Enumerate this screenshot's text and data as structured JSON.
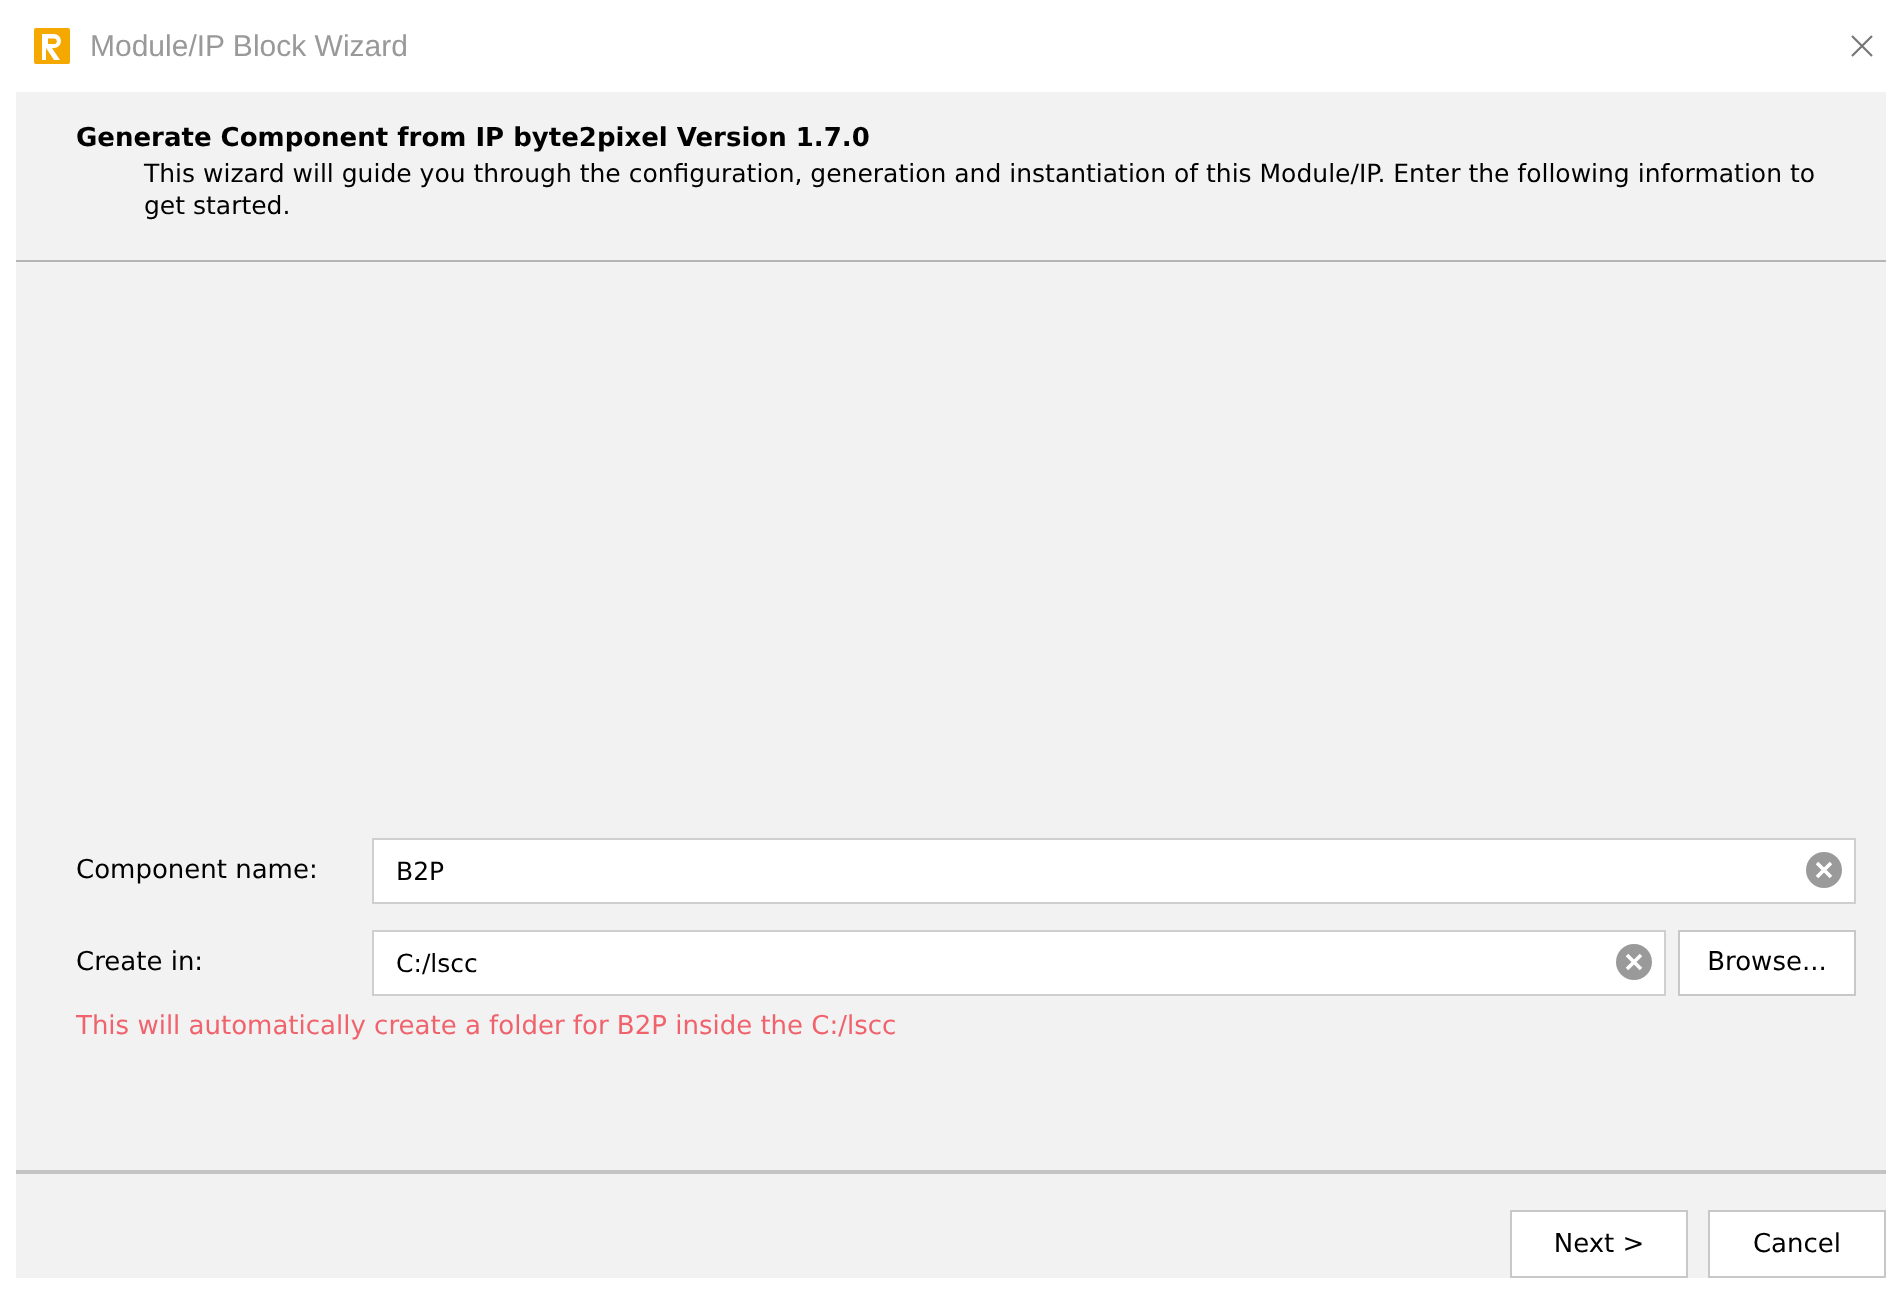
{
  "window": {
    "title": "Module/IP Block Wizard"
  },
  "header": {
    "title": "Generate Component from IP byte2pixel Version 1.7.0",
    "description": "This wizard will guide you through the configuration, generation and instantiation of this Module/IP. Enter the following information to get started."
  },
  "fields": [
    {
      "label": "Component name:",
      "value": "B2P",
      "browse": false
    },
    {
      "label": "Create in:",
      "value": "C:/lscc",
      "browse": true,
      "browse_label": "Browse..."
    }
  ],
  "hint": "This will automatically create a folder for B2P inside the C:/lscc",
  "buttons": [
    "Next >",
    "Cancel"
  ]
}
